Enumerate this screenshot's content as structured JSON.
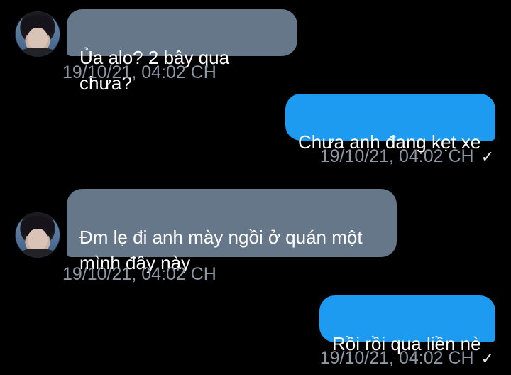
{
  "messages": [
    {
      "direction": "received",
      "text": "Ủa alo? 2 bây qua chưa?",
      "timestamp": "19/10/21, 04:02 CH",
      "has_avatar": true
    },
    {
      "direction": "sent",
      "text": "Chưa anh đang kẹt xe",
      "timestamp": "19/10/21, 04:02 CH",
      "status_icon": "✓"
    },
    {
      "direction": "received",
      "text": "Đm lẹ đi anh mày ngồi ở quán một\nmình đây này",
      "timestamp": "19/10/21, 04:02 CH",
      "has_avatar": true
    },
    {
      "direction": "sent",
      "text": "Rồi rồi qua liền nè",
      "timestamp": "19/10/21, 04:02 CH",
      "status_icon": "✓"
    }
  ],
  "colors": {
    "background": "#000000",
    "received_bubble": "#66778a",
    "sent_bubble": "#1d9bf0",
    "timestamp": "#8b98a5"
  }
}
